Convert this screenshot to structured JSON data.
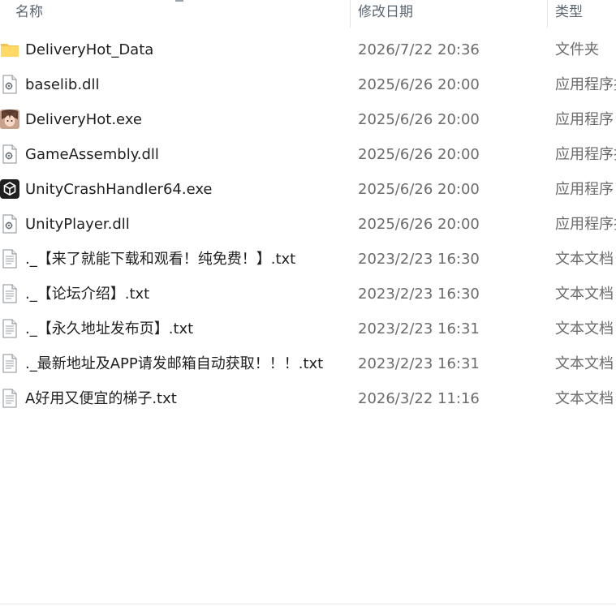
{
  "columns": {
    "name": "名称",
    "date": "修改日期",
    "type": "类型"
  },
  "files": [
    {
      "name": "DeliveryHot_Data",
      "date": "2026/7/22 20:36",
      "type": "文件夹",
      "icon": "folder-icon"
    },
    {
      "name": "baselib.dll",
      "date": "2025/6/26 20:00",
      "type": "应用程序扩展",
      "icon": "dll-file-icon"
    },
    {
      "name": "DeliveryHot.exe",
      "date": "2025/6/26 20:00",
      "type": "应用程序",
      "icon": "game-exe-icon"
    },
    {
      "name": "GameAssembly.dll",
      "date": "2025/6/26 20:00",
      "type": "应用程序扩展",
      "icon": "dll-file-icon"
    },
    {
      "name": "UnityCrashHandler64.exe",
      "date": "2025/6/26 20:00",
      "type": "应用程序",
      "icon": "unity-icon"
    },
    {
      "name": "UnityPlayer.dll",
      "date": "2025/6/26 20:00",
      "type": "应用程序扩展",
      "icon": "dll-file-icon"
    },
    {
      "name": "._【来了就能下载和观看！纯免费！】.txt",
      "date": "2023/2/23 16:30",
      "type": "文本文档",
      "icon": "text-file-icon"
    },
    {
      "name": "._【论坛介绍】.txt",
      "date": "2023/2/23 16:30",
      "type": "文本文档",
      "icon": "text-file-icon"
    },
    {
      "name": "._【永久地址发布页】.txt",
      "date": "2023/2/23 16:31",
      "type": "文本文档",
      "icon": "text-file-icon"
    },
    {
      "name": "._最新地址及APP请发邮箱自动获取！！！.txt",
      "date": "2023/2/23 16:31",
      "type": "文本文档",
      "icon": "text-file-icon"
    },
    {
      "name": "A好用又便宜的梯子.txt",
      "date": "2026/3/22 11:16",
      "type": "文本文档",
      "icon": "text-file-icon"
    }
  ]
}
